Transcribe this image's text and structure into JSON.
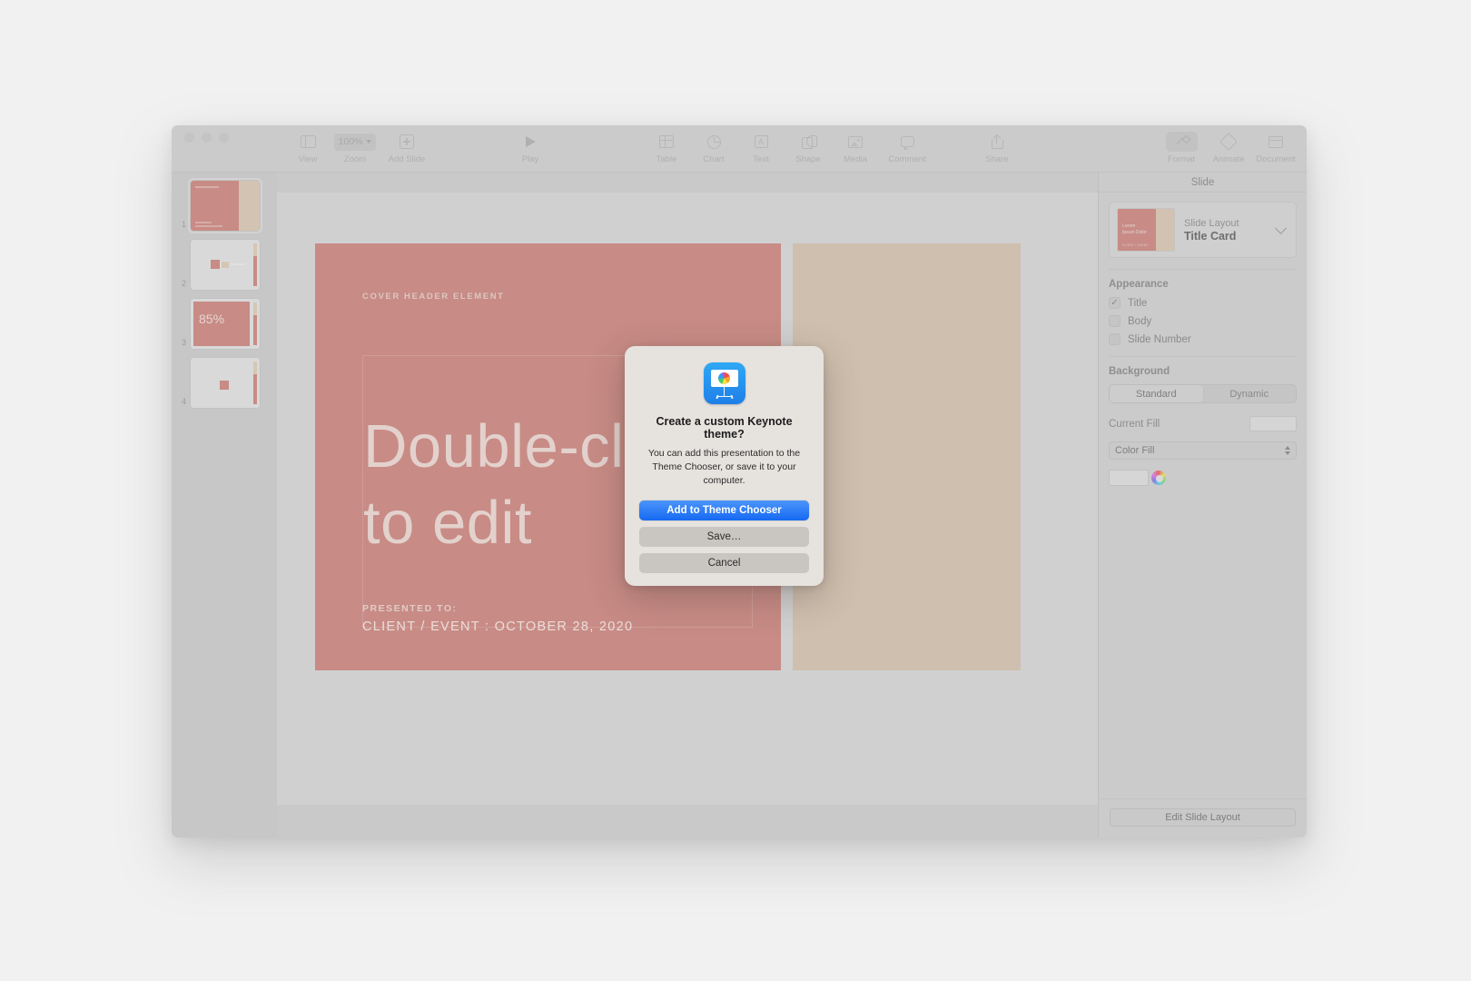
{
  "window": {
    "traffic_lights": [
      "close",
      "minimize",
      "zoom"
    ]
  },
  "toolbar": {
    "items": [
      {
        "icon": "sidebar-icon",
        "label": "View"
      },
      {
        "icon": "zoom-icon",
        "label": "Zoom",
        "value": "100%"
      },
      {
        "icon": "plus-slide-icon",
        "label": "Add Slide"
      },
      {
        "icon": "play-icon",
        "label": "Play"
      },
      {
        "icon": "table-icon",
        "label": "Table"
      },
      {
        "icon": "chart-icon",
        "label": "Chart"
      },
      {
        "icon": "text-icon",
        "label": "Text"
      },
      {
        "icon": "shape-icon",
        "label": "Shape"
      },
      {
        "icon": "media-icon",
        "label": "Media"
      },
      {
        "icon": "comment-icon",
        "label": "Comment"
      },
      {
        "icon": "share-icon",
        "label": "Share"
      },
      {
        "icon": "format-icon",
        "label": "Format"
      },
      {
        "icon": "animate-icon",
        "label": "Animate"
      },
      {
        "icon": "document-icon",
        "label": "Document"
      }
    ]
  },
  "navigator": {
    "slides": [
      {
        "number": "1",
        "selected": true,
        "style": "title-card"
      },
      {
        "number": "2",
        "selected": false,
        "style": "two-swatch"
      },
      {
        "number": "3",
        "selected": false,
        "style": "big-stat",
        "stat": "85%"
      },
      {
        "number": "4",
        "selected": false,
        "style": "single-swatch"
      }
    ]
  },
  "slide": {
    "cover_header": "COVER HEADER ELEMENT",
    "title": "Double-click\nto edit",
    "presented_to_label": "PRESENTED TO:",
    "client_event": "CLIENT / EVENT : OCTOBER 28, 2020",
    "left_color": "#c88b85",
    "right_color": "#cfbfae"
  },
  "inspector": {
    "header": "Slide",
    "layout": {
      "label": "Slide Layout",
      "value": "Title Card",
      "thumb_title": "Lorem\nIpsum Dolor",
      "thumb_footer": "CLIENT / EVENT"
    },
    "appearance": {
      "title": "Appearance",
      "options": [
        {
          "label": "Title",
          "checked": true
        },
        {
          "label": "Body",
          "checked": false
        },
        {
          "label": "Slide Number",
          "checked": false
        }
      ]
    },
    "background": {
      "title": "Background",
      "segments": [
        {
          "label": "Standard",
          "active": true
        },
        {
          "label": "Dynamic",
          "active": false
        }
      ],
      "current_fill_label": "Current Fill",
      "fill_type": "Color Fill"
    },
    "footer_button": "Edit Slide Layout"
  },
  "dialog": {
    "icon": "keynote-app-icon",
    "title": "Create a custom Keynote theme?",
    "message": "You can add this presentation to the Theme Chooser, or save it to your computer.",
    "buttons": [
      {
        "label": "Add to Theme Chooser",
        "kind": "primary"
      },
      {
        "label": "Save…",
        "kind": "secondary"
      },
      {
        "label": "Cancel",
        "kind": "secondary"
      }
    ]
  },
  "colors": {
    "accent_blue": "#1669f2",
    "slide_rose": "#c88b85",
    "slide_beige": "#cfbfae"
  }
}
